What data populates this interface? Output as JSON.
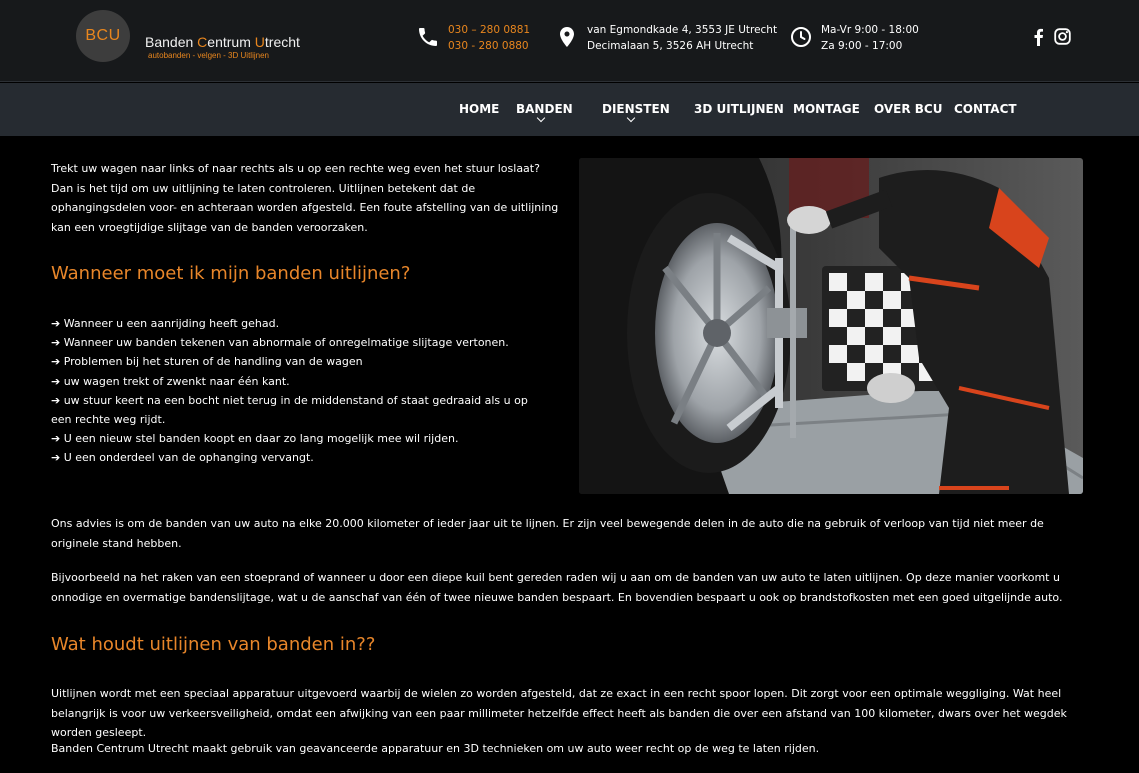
{
  "logo": {
    "initials": "BCU",
    "name_part1": "Banden ",
    "name_c": "C",
    "name_part2": "entrum ",
    "name_u": "U",
    "name_part3": "trecht",
    "tagline": "autobanden - velgen - 3D Uitlijnen"
  },
  "contact": {
    "phone1": "030 – 280 0881",
    "phone2": "030 - 280 0880",
    "address1": "van Egmondkade 4, 3553 JE Utrecht",
    "address2": "Decimalaan 5, 3526 AH Utrecht",
    "hours1": "Ma-Vr 9:00 - 18:00",
    "hours2": "Za 9:00 - 17:00"
  },
  "nav": {
    "home": "HOME",
    "banden": "BANDEN",
    "diensten": "DIENSTEN",
    "uitlijnen": "3D UITLIJNEN",
    "montage": "MONTAGE",
    "over": "OVER BCU",
    "contact": "CONTACT"
  },
  "main": {
    "intro": "Trekt uw wagen naar links of naar rechts als u op een rechte weg even het stuur loslaat? Dan is het tijd om uw uitlijning te laten controleren. Uitlijnen betekent dat de ophangingsdelen voor- en achteraan worden afgesteld. Een foute afstelling van de uitlijning kan een vroegtijdige slijtage van de banden veroorzaken.",
    "heading1": "Wanneer moet ik mijn banden uitlijnen?",
    "bullets": [
      "➔ Wanneer u een aanrijding heeft gehad.",
      "➔ Wanneer uw banden tekenen van abnormale of onregelmatige slijtage vertonen.",
      "➔ Problemen bij het sturen of de handling van de wagen",
      "➔ uw wagen trekt of zwenkt naar één kant.",
      "➔ uw stuur keert na een bocht niet terug in de middenstand of staat gedraaid als u op een rechte weg rijdt.",
      "➔ U een nieuw stel banden koopt en daar zo lang mogelijk mee wil rijden.",
      "➔ U een onderdeel van de ophanging vervangt."
    ],
    "advice": "Ons advies is om de banden van uw auto na elke 20.000 kilometer of ieder jaar uit te lijnen. Er zijn veel bewegende delen in de auto die na gebruik of verloop van tijd niet meer de originele stand hebben.",
    "example": "Bijvoorbeeld na het raken van een stoeprand of wanneer u door een diepe kuil bent gereden raden wij u aan om de banden van uw auto te laten uitlijnen. Op deze manier voorkomt u onnodige en overmatige bandenslijtage, wat u de aanschaf van één of twee nieuwe banden bespaart. En bovendien bespaart u ook op brandstofkosten met een goed uitgelijnde auto.",
    "heading2": "Wat houdt uitlijnen van banden in??",
    "explain": "Uitlijnen wordt met een speciaal apparatuur uitgevoerd waarbij de wielen zo worden afgesteld, dat ze exact in een recht spoor lopen. Dit zorgt voor een optimale weggliging. Wat heel belangrijk is voor uw verkeersveiligheid, omdat een afwijking van een paar millimeter hetzelfde effect heeft als banden die over een afstand van 100 kilometer, dwars over het wegdek worden gesleept.",
    "closing": "Banden Centrum Utrecht maakt gebruik van geavanceerde apparatuur en 3D technieken om uw auto weer recht op de weg te laten rijden."
  },
  "colors": {
    "accent": "#e8861e",
    "topbar": "#17191b",
    "navbar": "#262b31",
    "background": "#000000"
  },
  "icons": [
    "phone-icon",
    "map-pin-icon",
    "clock-icon",
    "facebook-icon",
    "instagram-icon",
    "chevron-down-icon"
  ]
}
